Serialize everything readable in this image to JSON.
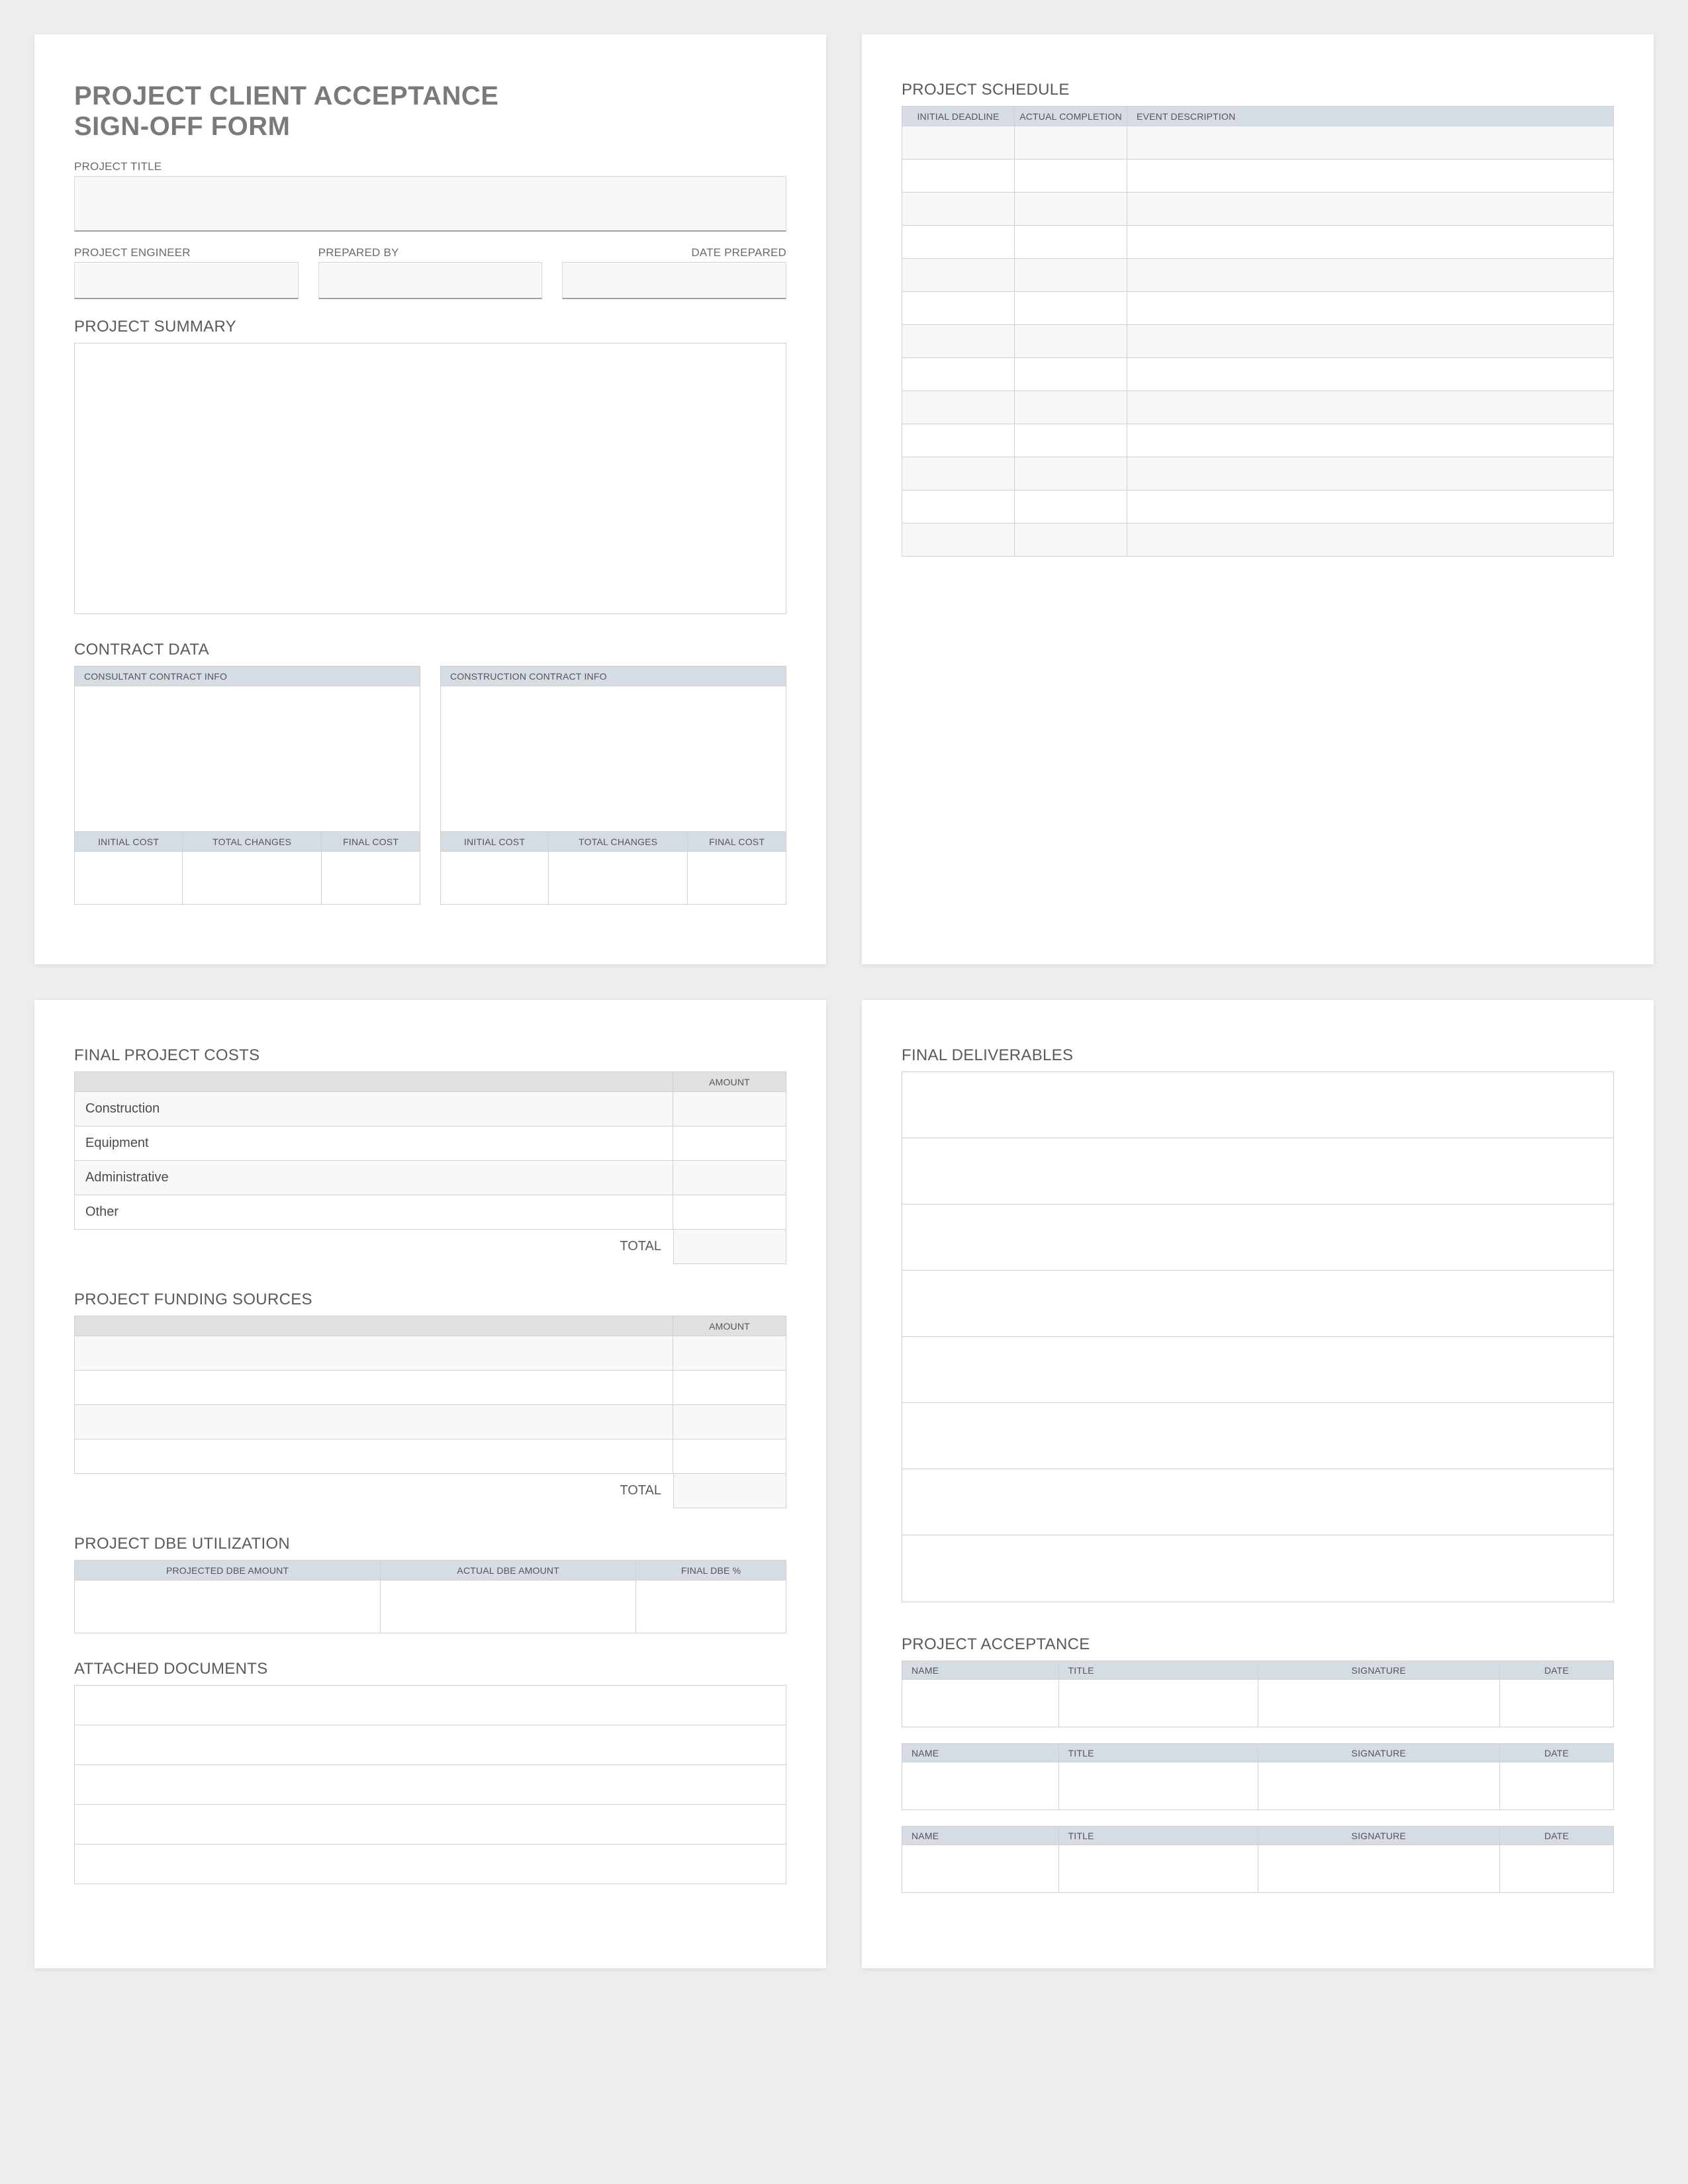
{
  "title_line1": "PROJECT CLIENT ACCEPTANCE",
  "title_line2": "SIGN-OFF FORM",
  "labels": {
    "project_title": "PROJECT TITLE",
    "project_engineer": "PROJECT ENGINEER",
    "prepared_by": "PREPARED BY",
    "date_prepared": "DATE PREPARED",
    "project_summary": "PROJECT SUMMARY",
    "contract_data": "CONTRACT DATA",
    "consultant_contract_info": "CONSULTANT CONTRACT INFO",
    "construction_contract_info": "CONSTRUCTION CONTRACT INFO",
    "initial_cost": "INITIAL COST",
    "total_changes": "TOTAL CHANGES",
    "final_cost": "FINAL COST",
    "project_schedule": "PROJECT SCHEDULE",
    "initial_deadline": "INITIAL DEADLINE",
    "actual_completion": "ACTUAL COMPLETION",
    "event_description": "EVENT DESCRIPTION",
    "final_project_costs": "FINAL PROJECT COSTS",
    "amount": "AMOUNT",
    "total": "TOTAL",
    "project_funding_sources": "PROJECT FUNDING SOURCES",
    "project_dbe_utilization": "PROJECT DBE UTILIZATION",
    "projected_dbe_amount": "PROJECTED DBE AMOUNT",
    "actual_dbe_amount": "ACTUAL DBE AMOUNT",
    "final_dbe_pct": "FINAL DBE %",
    "attached_documents": "ATTACHED DOCUMENTS",
    "final_deliverables": "FINAL DELIVERABLES",
    "project_acceptance": "PROJECT ACCEPTANCE",
    "name": "NAME",
    "title_col": "TITLE",
    "signature": "SIGNATURE",
    "date": "DATE"
  },
  "final_project_costs": {
    "rows": [
      "Construction",
      "Equipment",
      "Administrative",
      "Other"
    ]
  },
  "schedule_rows": 13,
  "funding_rows": 4,
  "attached_rows": 5,
  "deliverable_rows": 8,
  "acceptance_blocks": 3
}
